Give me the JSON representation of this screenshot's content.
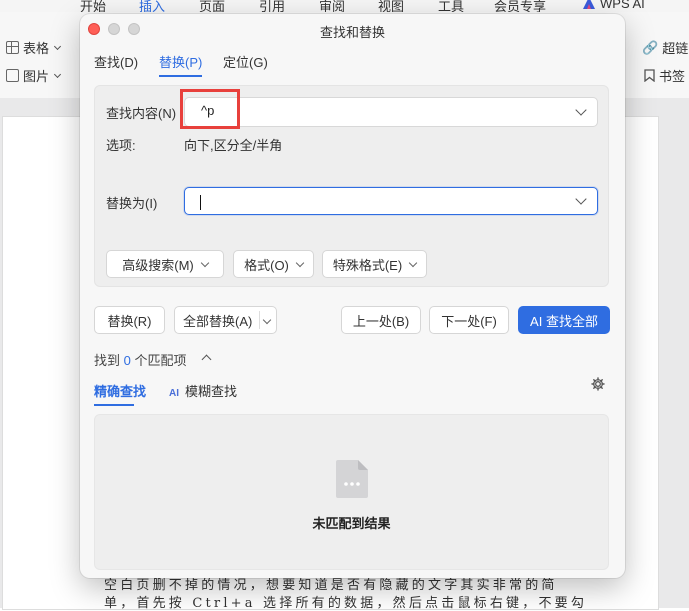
{
  "app": {
    "menu": [
      {
        "label": "开始",
        "active": false
      },
      {
        "label": "插入",
        "active": true
      },
      {
        "label": "页面",
        "active": false
      },
      {
        "label": "引用",
        "active": false
      },
      {
        "label": "审阅",
        "active": false
      },
      {
        "label": "视图",
        "active": false
      },
      {
        "label": "工具",
        "active": false
      },
      {
        "label": "会员专享",
        "active": false
      },
      {
        "label": "WPS AI",
        "active": false
      }
    ],
    "ribbon_left": [
      "表格",
      "图片"
    ],
    "ribbon_right": [
      "超链",
      "书签"
    ],
    "document_lines": [
      "空白页删不掉的情况，想要知道是否有隐藏的文字其实非常的简",
      "单，首先按 Ctrl+a 选择所有的数据，然后点击鼠标右键，不要勾"
    ]
  },
  "dialog": {
    "title": "查找和替换",
    "tabs": [
      "查找(D)",
      "替换(P)",
      "定位(G)"
    ],
    "active_tab": "替换(P)",
    "find_label": "查找内容(N)",
    "find_value": "^p",
    "options_label": "选项:",
    "options_value": "向下,区分全/半角",
    "replace_label": "替换为(I)",
    "replace_value": "",
    "buttons": {
      "advanced": "高级搜索(M)",
      "format": "格式(O)",
      "special": "特殊格式(E)",
      "replace": "替换(R)",
      "replace_all": "全部替换(A)",
      "prev": "上一处(B)",
      "next": "下一处(F)",
      "ai_find_all": "AI 查找全部"
    },
    "found_prefix": "找到",
    "found_count": "0",
    "found_suffix": "个匹配项",
    "subtabs": {
      "exact": "精确查找",
      "fuzzy_badge": "AI",
      "fuzzy": "模糊查找"
    },
    "empty_message": "未匹配到结果"
  },
  "colors": {
    "accent": "#2f6de1",
    "highlight": "#e8403c"
  }
}
